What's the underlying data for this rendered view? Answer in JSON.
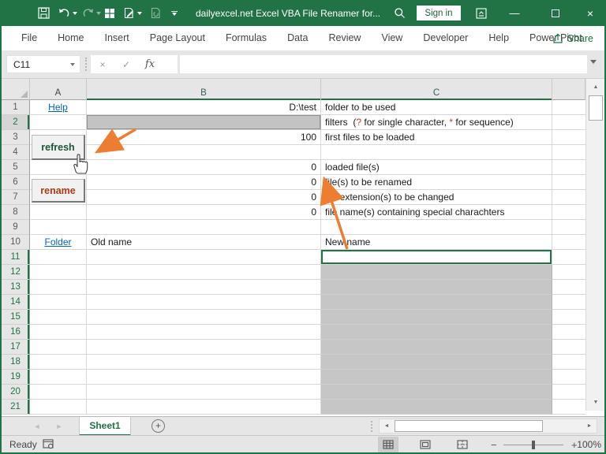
{
  "window": {
    "title": "dailyexcel.net Excel VBA File Renamer for...",
    "sign_in_label": "Sign in"
  },
  "icons": {
    "qat": [
      "save-icon",
      "undo-icon",
      "redo-icon",
      "grid-icon",
      "document-pen-icon",
      "document-refresh-icon",
      "customize-qat-chevron"
    ],
    "close_glyph": "×",
    "minimize_glyph": "—",
    "cancel_glyph": "×",
    "enter_glyph": "✓",
    "fx_label": "fx",
    "nav_left": "◄",
    "nav_right": "►",
    "scroll_up": "▲",
    "scroll_down": "▼",
    "scroll_left": "◄",
    "scroll_right": "►",
    "add_sheet": "+",
    "zoom_minus": "−",
    "zoom_plus": "+"
  },
  "ribbon": {
    "tabs": [
      "File",
      "Home",
      "Insert",
      "Page Layout",
      "Formulas",
      "Data",
      "Review",
      "View",
      "Developer",
      "Help",
      "Power Pivot"
    ],
    "share_label": "Share"
  },
  "formula_bar": {
    "name_box": "C11",
    "formula_value": ""
  },
  "grid": {
    "column_headers": [
      {
        "label": "A",
        "sel": false
      },
      {
        "label": "B",
        "sel": true
      },
      {
        "label": "C",
        "sel": true
      }
    ],
    "filters_parts": [
      {
        "text": "filters  ("
      },
      {
        "text": "?",
        "accent": true
      },
      {
        "text": " for single character, "
      },
      {
        "text": "*",
        "accent": true
      },
      {
        "text": " for sequence)"
      }
    ],
    "rows": [
      {
        "n": "1",
        "cells": [
          {
            "col": "A",
            "text": "Help",
            "kind": "link",
            "name": "help-link"
          },
          {
            "col": "B",
            "text": "D:\\test",
            "kind": "num"
          },
          {
            "col": "C",
            "text": "folder to be used"
          }
        ]
      },
      {
        "n": "2",
        "sel": true,
        "dim": true,
        "cells": [
          {
            "col": "B",
            "kind": "grayfill",
            "outline": true
          },
          {
            "col": "C",
            "kind": "filters"
          }
        ]
      },
      {
        "n": "3",
        "cells": [
          {
            "col": "B",
            "text": "100",
            "kind": "num"
          },
          {
            "col": "C",
            "text": "first files to be loaded"
          }
        ]
      },
      {
        "n": "4",
        "cells": []
      },
      {
        "n": "5",
        "cells": [
          {
            "col": "B",
            "text": "0",
            "kind": "num"
          },
          {
            "col": "C",
            "text": "loaded file(s)"
          }
        ]
      },
      {
        "n": "6",
        "cells": [
          {
            "col": "B",
            "text": "0",
            "kind": "num"
          },
          {
            "col": "C",
            "text": "file(s) to be renamed"
          }
        ]
      },
      {
        "n": "7",
        "cells": [
          {
            "col": "B",
            "text": "0",
            "kind": "num"
          },
          {
            "col": "C",
            "text": "file extension(s) to be changed"
          }
        ]
      },
      {
        "n": "8",
        "cells": [
          {
            "col": "B",
            "text": "0",
            "kind": "num"
          },
          {
            "col": "C",
            "text": "file name(s) containing special charachters"
          }
        ]
      },
      {
        "n": "9",
        "cells": []
      },
      {
        "n": "10",
        "cells": [
          {
            "col": "A",
            "text": "Folder",
            "kind": "link",
            "name": "folder-link"
          },
          {
            "col": "B",
            "text": "Old name"
          },
          {
            "col": "C",
            "text": "New name"
          }
        ]
      },
      {
        "n": "11",
        "sel": true,
        "cells": [
          {
            "col": "C",
            "kind": "active"
          }
        ]
      },
      {
        "n": "12",
        "sel": true,
        "cells": [
          {
            "col": "C",
            "kind": "grayfill"
          }
        ]
      },
      {
        "n": "13",
        "sel": true,
        "cells": [
          {
            "col": "C",
            "kind": "grayfill"
          }
        ]
      },
      {
        "n": "14",
        "sel": true,
        "cells": [
          {
            "col": "C",
            "kind": "grayfill"
          }
        ]
      },
      {
        "n": "15",
        "sel": true,
        "cells": [
          {
            "col": "C",
            "kind": "grayfill"
          }
        ]
      },
      {
        "n": "16",
        "sel": true,
        "cells": [
          {
            "col": "C",
            "kind": "grayfill"
          }
        ]
      },
      {
        "n": "17",
        "sel": true,
        "cells": [
          {
            "col": "C",
            "kind": "grayfill"
          }
        ]
      },
      {
        "n": "18",
        "sel": true,
        "cells": [
          {
            "col": "C",
            "kind": "grayfill"
          }
        ]
      },
      {
        "n": "19",
        "sel": true,
        "cells": [
          {
            "col": "C",
            "kind": "grayfill"
          }
        ]
      },
      {
        "n": "20",
        "sel": true,
        "cells": [
          {
            "col": "C",
            "kind": "grayfill"
          }
        ]
      },
      {
        "n": "21",
        "sel": true,
        "cells": [
          {
            "col": "C",
            "kind": "grayfill"
          }
        ]
      }
    ]
  },
  "buttons": {
    "refresh_label": "refresh",
    "rename_label": "rename"
  },
  "sheet_bar": {
    "active_tab": "Sheet1"
  },
  "status_bar": {
    "ready_label": "Ready",
    "zoom_percent": "100%"
  },
  "colors": {
    "titlebar_green": "#217346",
    "link_blue": "#0563C1",
    "special_char_red": "#D03A20",
    "arrow_orange": "#ED7D31",
    "gray_fill": "#C6C6C6",
    "refresh_text": "#1D5336",
    "rename_text": "#AE3A10"
  }
}
